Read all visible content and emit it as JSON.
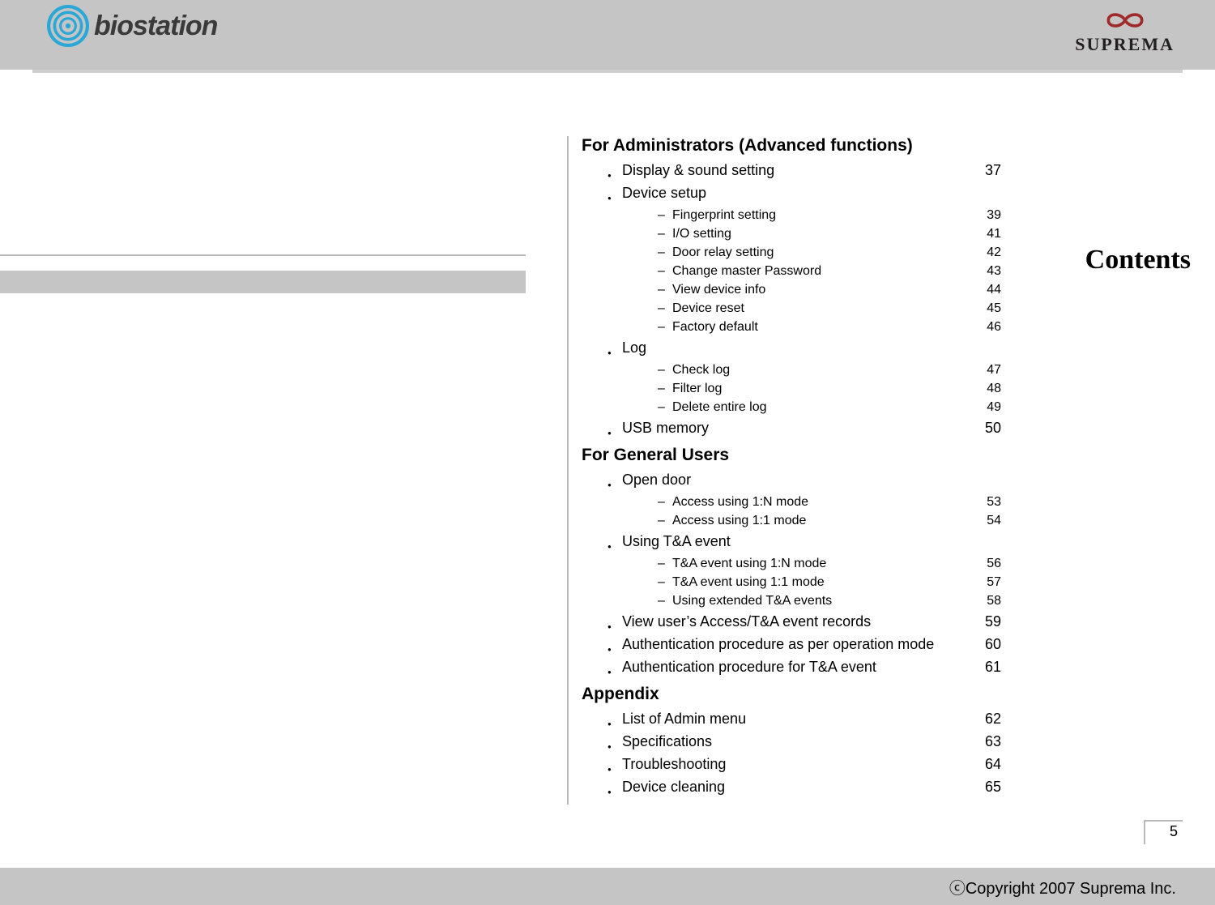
{
  "header": {
    "logo_left_name": "biostation",
    "logo_right_name": "SUPREMA"
  },
  "left": {
    "heading": "Contents"
  },
  "toc": {
    "sections": [
      {
        "title": "For Administrators (Advanced functions)",
        "items": [
          {
            "label": "Display & sound setting",
            "page": "37"
          },
          {
            "label": "Device setup",
            "page": "",
            "children": [
              {
                "label": "Fingerprint setting",
                "page": "39"
              },
              {
                "label": "I/O setting",
                "page": "41"
              },
              {
                "label": "Door relay setting",
                "page": "42"
              },
              {
                "label": "Change master Password",
                "page": "43"
              },
              {
                "label": "View device info",
                "page": "44"
              },
              {
                "label": "Device reset",
                "page": "45"
              },
              {
                "label": "Factory default",
                "page": "46"
              }
            ]
          },
          {
            "label": "Log",
            "page": "",
            "children": [
              {
                "label": "Check log",
                "page": "47"
              },
              {
                "label": "Filter log",
                "page": "48"
              },
              {
                "label": "Delete entire log",
                "page": "49"
              }
            ]
          },
          {
            "label": "USB memory",
            "page": "50"
          }
        ]
      },
      {
        "title": "For General Users",
        "items": [
          {
            "label": "Open door",
            "page": "",
            "children": [
              {
                "label": "Access using 1:N mode",
                "page": "53"
              },
              {
                "label": "Access using 1:1 mode",
                "page": "54"
              }
            ]
          },
          {
            "label": "Using T&A event",
            "page": "",
            "children": [
              {
                "label": "T&A event using 1:N mode",
                "page": "56"
              },
              {
                "label": "T&A event using 1:1 mode",
                "page": "57"
              },
              {
                "label": "Using extended T&A events",
                "page": "58"
              }
            ]
          },
          {
            "label": "View user’s Access/T&A event records",
            "page": "59"
          },
          {
            "label": "Authentication procedure as per operation mode",
            "page": "60"
          },
          {
            "label": "Authentication procedure for T&A event",
            "page": "61"
          }
        ]
      },
      {
        "title": "Appendix",
        "items": [
          {
            "label": "List of Admin menu",
            "page": "62"
          },
          {
            "label": "Specifications",
            "page": "63"
          },
          {
            "label": "Troubleshooting",
            "page": "64"
          },
          {
            "label": "Device cleaning",
            "page": "65"
          }
        ]
      }
    ]
  },
  "page_number": "5",
  "footer": {
    "copyright": "ⓒCopyright 2007 Suprema Inc."
  }
}
